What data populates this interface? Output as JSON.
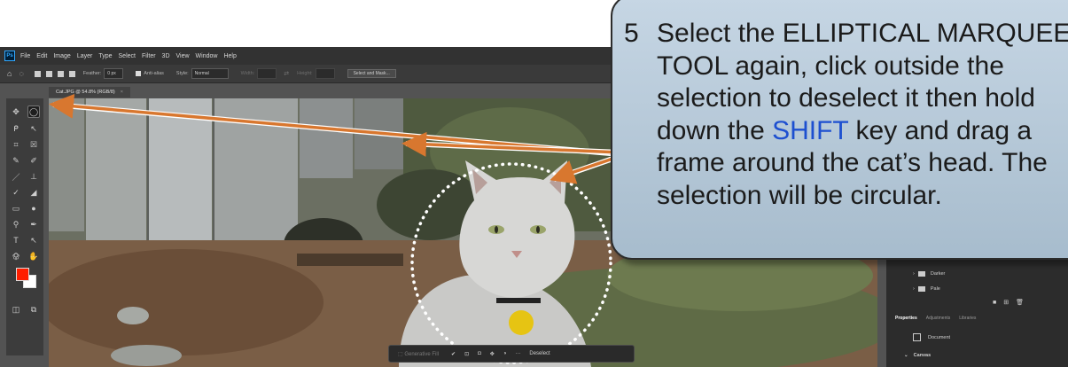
{
  "photoshop": {
    "app_badge": "Ps",
    "menu": [
      "File",
      "Edit",
      "Image",
      "Layer",
      "Type",
      "Select",
      "Filter",
      "3D",
      "View",
      "Window",
      "Help"
    ],
    "options_bar": {
      "feather_label": "Feather:",
      "feather_value": "0 px",
      "anti_alias_label": "Anti-alias",
      "style_label": "Style:",
      "style_value": "Normal",
      "width_label": "Width:",
      "height_label": "Height:",
      "select_and_mask": "Select and Mask..."
    },
    "document_tab": "Cat.JPG @ 54.8% (RGB/8)",
    "document_tab_close": "×",
    "layers": [
      {
        "name": "Darker"
      },
      {
        "name": "Pale"
      }
    ],
    "panel_tabs": [
      "Properties",
      "Adjustments",
      "Libraries"
    ],
    "properties": {
      "document_label": "Document",
      "canvas_label": "Canvas"
    },
    "context_bar": {
      "generative_fill": "Generative Fill",
      "more": "···",
      "deselect": "Deselect"
    },
    "colors": {
      "foreground": "#ff1e00",
      "background": "#ffffff",
      "ui_dark": "#323232"
    }
  },
  "callout": {
    "step_number": "5",
    "line1": "Select the ELLIPTICAL MARQUEE",
    "line2": "TOOL again, click outside the",
    "line3": "selection to deselect it then hold",
    "line4_pre": "down the ",
    "line4_key": "SHIFT",
    "line4_post": " key and drag a",
    "line5": "frame around the cat’s head.  The",
    "line6": "selection will be circular."
  },
  "arrow_color": "#d8772f",
  "selection_shape": "circle"
}
